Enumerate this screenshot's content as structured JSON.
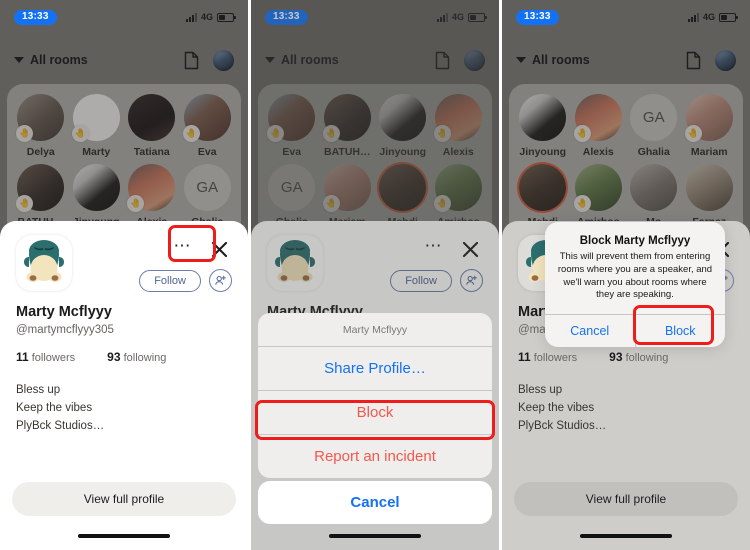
{
  "status_bar": {
    "time": "13:33",
    "network": "4G",
    "signal_icon": "signal-bars-icon",
    "battery_icon": "battery-icon"
  },
  "nav": {
    "rooms_label": "All rooms",
    "chevron_icon": "chevron-down-icon",
    "document_icon": "document-icon",
    "avatar_icon": "user-avatar-icon"
  },
  "room_grid": {
    "panel1": [
      {
        "name": "Delya",
        "photo": "p-delya",
        "initials": "",
        "hand": "🤚",
        "ring": false
      },
      {
        "name": "Marty",
        "photo": "p-marty",
        "initials": "",
        "hand": "🤚",
        "ring": false
      },
      {
        "name": "Tatiana",
        "photo": "p-tatiana",
        "initials": "",
        "hand": "",
        "ring": false
      },
      {
        "name": "Eva",
        "photo": "p-eva",
        "initials": "",
        "hand": "🤚",
        "ring": false
      },
      {
        "name": "BATUH…",
        "photo": "p-batuh",
        "initials": "",
        "hand": "🤚",
        "ring": false
      },
      {
        "name": "Jinyoung",
        "photo": "p-jin",
        "initials": "",
        "hand": "",
        "ring": false
      },
      {
        "name": "Alexis",
        "photo": "p-alexis",
        "initials": "",
        "hand": "🤚",
        "ring": false
      },
      {
        "name": "Ghalia",
        "photo": "p-ghalia",
        "initials": "GA",
        "hand": "",
        "ring": false
      }
    ],
    "panel2": [
      {
        "name": "Eva",
        "photo": "p-eva",
        "initials": "",
        "hand": "🤚",
        "ring": false
      },
      {
        "name": "BATUH…",
        "photo": "p-batuh",
        "initials": "",
        "hand": "🤚",
        "ring": false
      },
      {
        "name": "Jinyoung",
        "photo": "p-jin",
        "initials": "",
        "hand": "",
        "ring": false
      },
      {
        "name": "Alexis",
        "photo": "p-alexis",
        "initials": "",
        "hand": "🤚",
        "ring": false
      },
      {
        "name": "Ghalia",
        "photo": "p-ghalia",
        "initials": "GA",
        "hand": "",
        "ring": false
      },
      {
        "name": "Mariam",
        "photo": "p-mariam",
        "initials": "",
        "hand": "🤚",
        "ring": false
      },
      {
        "name": "Mehdi",
        "photo": "p-mehdi",
        "initials": "",
        "hand": "",
        "ring": true
      },
      {
        "name": "Amirhos",
        "photo": "p-amirhos",
        "initials": "",
        "hand": "🤚",
        "ring": false
      }
    ],
    "panel3": [
      {
        "name": "Jinyoung",
        "photo": "p-jin",
        "initials": "",
        "hand": "",
        "ring": false
      },
      {
        "name": "Alexis",
        "photo": "p-alexis",
        "initials": "",
        "hand": "🤚",
        "ring": false
      },
      {
        "name": "Ghalia",
        "photo": "p-ghalia",
        "initials": "GA",
        "hand": "",
        "ring": false
      },
      {
        "name": "Mariam",
        "photo": "p-mariam",
        "initials": "",
        "hand": "🤚",
        "ring": false
      },
      {
        "name": "Mehdi",
        "photo": "p-mehdi",
        "initials": "",
        "hand": "",
        "ring": true
      },
      {
        "name": "Amirhos",
        "photo": "p-amirhos",
        "initials": "",
        "hand": "🤚",
        "ring": false
      },
      {
        "name": "Mo",
        "photo": "p-mo",
        "initials": "",
        "hand": "",
        "ring": false
      },
      {
        "name": "Farnaz",
        "photo": "p-farnaz",
        "initials": "",
        "hand": "",
        "ring": false
      }
    ]
  },
  "profile": {
    "display_name": "Marty Mcflyyy",
    "handle": "@martymcflyyy305",
    "followers_count": "11",
    "followers_label": "followers",
    "following_count": "93",
    "following_label": "following",
    "bio_line1": "Bless up",
    "bio_line2": "Keep the vibes",
    "bio_line3": "PlyBck Studios…",
    "follow_label": "Follow",
    "view_profile_label": "View full profile",
    "more_icon": "more-horizontal-icon",
    "close_icon": "close-x-icon",
    "add_icon": "add-person-icon",
    "avatar_icon": "snorlax-avatar-icon"
  },
  "action_sheet": {
    "title": "Marty Mcflyyy",
    "items": [
      {
        "label": "Share Profile…",
        "style": "blue"
      },
      {
        "label": "Block",
        "style": "red"
      },
      {
        "label": "Report an incident",
        "style": "red"
      }
    ],
    "cancel_label": "Cancel"
  },
  "alert": {
    "title": "Block Marty Mcflyyy",
    "message": "This will prevent them from entering rooms where you are a speaker, and we'll warn you about rooms where they are speaking.",
    "cancel_label": "Cancel",
    "confirm_label": "Block"
  },
  "colors": {
    "accent_blue": "#1372f3",
    "destructive_red": "#f4584d",
    "annotation_red": "#ef1c1c",
    "sheet_white": "#ffffff",
    "dim_gray": "#cfcdc9"
  }
}
